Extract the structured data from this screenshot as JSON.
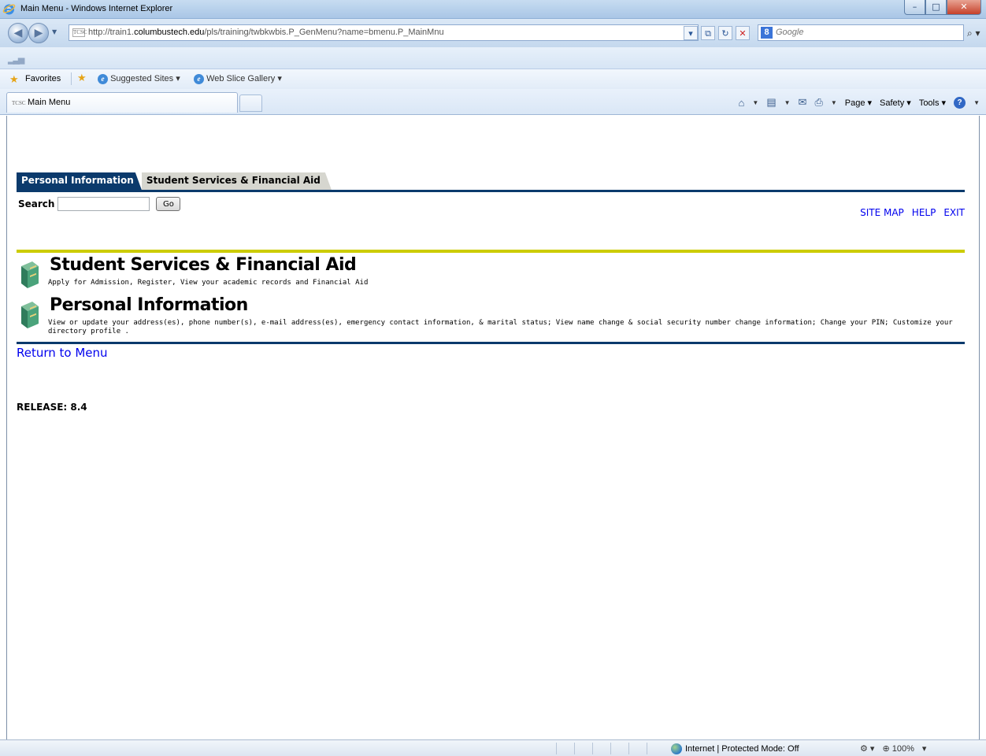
{
  "window": {
    "title": "Main Menu - Windows Internet Explorer",
    "minimize": "–",
    "maximize": "□",
    "close": "✕"
  },
  "address_bar": {
    "favicon_text": "TCSC",
    "url_prefix": "http://train1.",
    "url_domain": "columbustech.edu",
    "url_path": "/pls/training/twbkwbis.P_GenMenu?name=bmenu.P_MainMnu"
  },
  "search_box": {
    "engine_glyph": "8",
    "placeholder": "Google"
  },
  "favorites_bar": {
    "favorites_label": "Favorites",
    "links": [
      "Suggested Sites ▾",
      "Web Slice Gallery ▾"
    ]
  },
  "ie_tab": {
    "favicon_text": "TCSC",
    "label": "Main Menu"
  },
  "command_bar": {
    "page_label": "Page ▾",
    "safety_label": "Safety ▾",
    "tools_label": "Tools ▾"
  },
  "page": {
    "tabs": [
      "Personal Information",
      "Student Services & Financial Aid"
    ],
    "search_label": "Search",
    "go_label": "Go",
    "top_links": {
      "site_map": "SITE MAP",
      "help": "HELP",
      "exit": "EXIT"
    },
    "menu_items": [
      {
        "title": "Student Services & Financial Aid",
        "description": "Apply for Admission, Register, View your academic records and Financial Aid"
      },
      {
        "title": "Personal Information",
        "description": "View or update your address(es), phone number(s), e-mail address(es), emergency contact information, & marital status; View name change & social security number change information; Change your PIN; Customize your directory profile ."
      }
    ],
    "return_link": "Return to Menu",
    "release": "RELEASE: 8.4"
  },
  "status_bar": {
    "zone": "Internet | Protected Mode: Off",
    "zoom": "100%"
  },
  "colors": {
    "tab_active_bg": "#0b3a6c",
    "tab_inactive_bg": "#d6d6cf",
    "divider_yellow": "#cccc00",
    "link_blue": "#0000ee"
  }
}
